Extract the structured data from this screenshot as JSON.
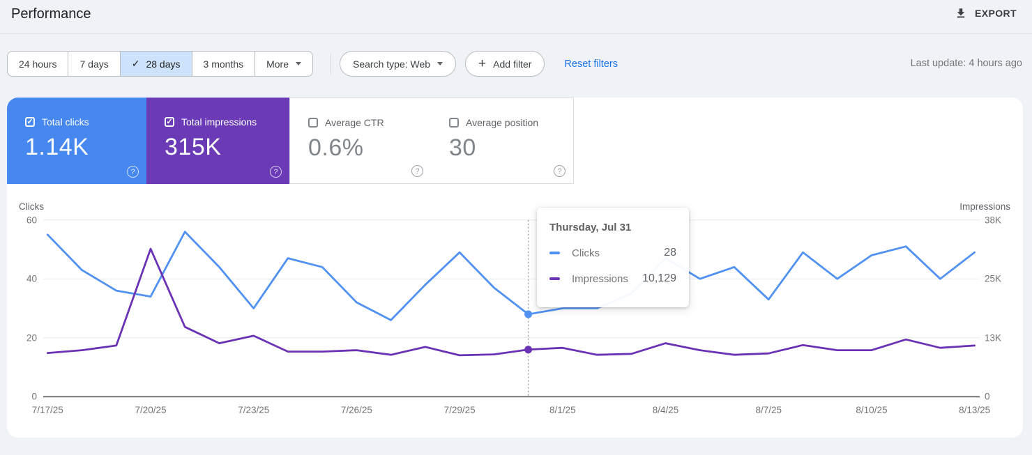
{
  "header": {
    "title": "Performance",
    "export_label": "EXPORT"
  },
  "filters": {
    "date_ranges": [
      {
        "label": "24 hours",
        "selected": false
      },
      {
        "label": "7 days",
        "selected": false
      },
      {
        "label": "28 days",
        "selected": true
      },
      {
        "label": "3 months",
        "selected": false
      },
      {
        "label": "More",
        "selected": false
      }
    ],
    "selected_check": "✓",
    "search_type_label": "Search type: Web",
    "add_filter_label": "Add filter",
    "add_filter_plus": "+",
    "reset_label": "Reset filters",
    "last_update": "Last update: 4 hours ago"
  },
  "cards": [
    {
      "label": "Total clicks",
      "value": "1.14K",
      "checked": true,
      "check_glyph": "✓",
      "help_glyph": "?",
      "color": "#4687f0"
    },
    {
      "label": "Total impressions",
      "value": "315K",
      "checked": true,
      "check_glyph": "✓",
      "help_glyph": "?",
      "color": "#6a3ab7"
    },
    {
      "label": "Average CTR",
      "value": "0.6%",
      "checked": false,
      "help_glyph": "?",
      "color": "#ffffff"
    },
    {
      "label": "Average position",
      "value": "30",
      "checked": false,
      "help_glyph": "?",
      "color": "#ffffff"
    }
  ],
  "tooltip": {
    "title": "Thursday, Jul 31",
    "rows": [
      {
        "label": "Clicks",
        "value": "28"
      },
      {
        "label": "Impressions",
        "value": "10,129"
      }
    ]
  },
  "colors": {
    "clicks_card": "#4687f0",
    "impressions_card": "#6a3ab7",
    "clicks_line": "#5091f2",
    "impressions_line": "#6b32b5",
    "selected_chip_bg": "#cde3fb",
    "reset_link": "#1a73e8",
    "gridline": "#e7e9ec",
    "axis_line": "#757575",
    "hover_line": "#9aa0a6"
  },
  "chart_data": {
    "type": "line",
    "x": [
      "7/17/25",
      "7/18/25",
      "7/19/25",
      "7/20/25",
      "7/21/25",
      "7/22/25",
      "7/23/25",
      "7/24/25",
      "7/25/25",
      "7/26/25",
      "7/27/25",
      "7/28/25",
      "7/29/25",
      "7/30/25",
      "7/31/25",
      "8/1/25",
      "8/2/25",
      "8/3/25",
      "8/4/25",
      "8/5/25",
      "8/6/25",
      "8/7/25",
      "8/8/25",
      "8/9/25",
      "8/10/25",
      "8/11/25",
      "8/12/25",
      "8/13/25"
    ],
    "series": [
      {
        "name": "Clicks",
        "axis": "left",
        "color": "#5091f2",
        "values": [
          55,
          43,
          36,
          34,
          56,
          44,
          30,
          47,
          44,
          32,
          26,
          38,
          49,
          37,
          28,
          30,
          30,
          35,
          47,
          40,
          44,
          33,
          49,
          40,
          48,
          51,
          40,
          49
        ]
      },
      {
        "name": "Impressions",
        "axis": "right",
        "color": "#6b32b5",
        "values": [
          9400,
          10000,
          11000,
          31800,
          15000,
          11500,
          13100,
          9700,
          9700,
          10000,
          9000,
          10700,
          8900,
          9100,
          10129,
          10500,
          9000,
          9200,
          11500,
          10000,
          9000,
          9300,
          11100,
          10000,
          10000,
          12300,
          10500,
          11000
        ]
      }
    ],
    "left_axis": {
      "title": "Clicks",
      "ticks": [
        "60",
        "40",
        "20",
        "0"
      ],
      "range": [
        0,
        60
      ]
    },
    "right_axis": {
      "title": "Impressions",
      "ticks": [
        "38K",
        "25K",
        "13K",
        "0"
      ],
      "range": [
        0,
        38000
      ]
    },
    "x_tick_labels": [
      "7/17/25",
      "7/20/25",
      "7/23/25",
      "7/26/25",
      "7/29/25",
      "8/1/25",
      "8/4/25",
      "8/7/25",
      "8/10/25",
      "8/13/25"
    ],
    "hover": {
      "index": 14,
      "date": "Thursday, Jul 31",
      "clicks": 28,
      "impressions": 10129
    },
    "grid": "horizontal",
    "legend_position": "none"
  }
}
